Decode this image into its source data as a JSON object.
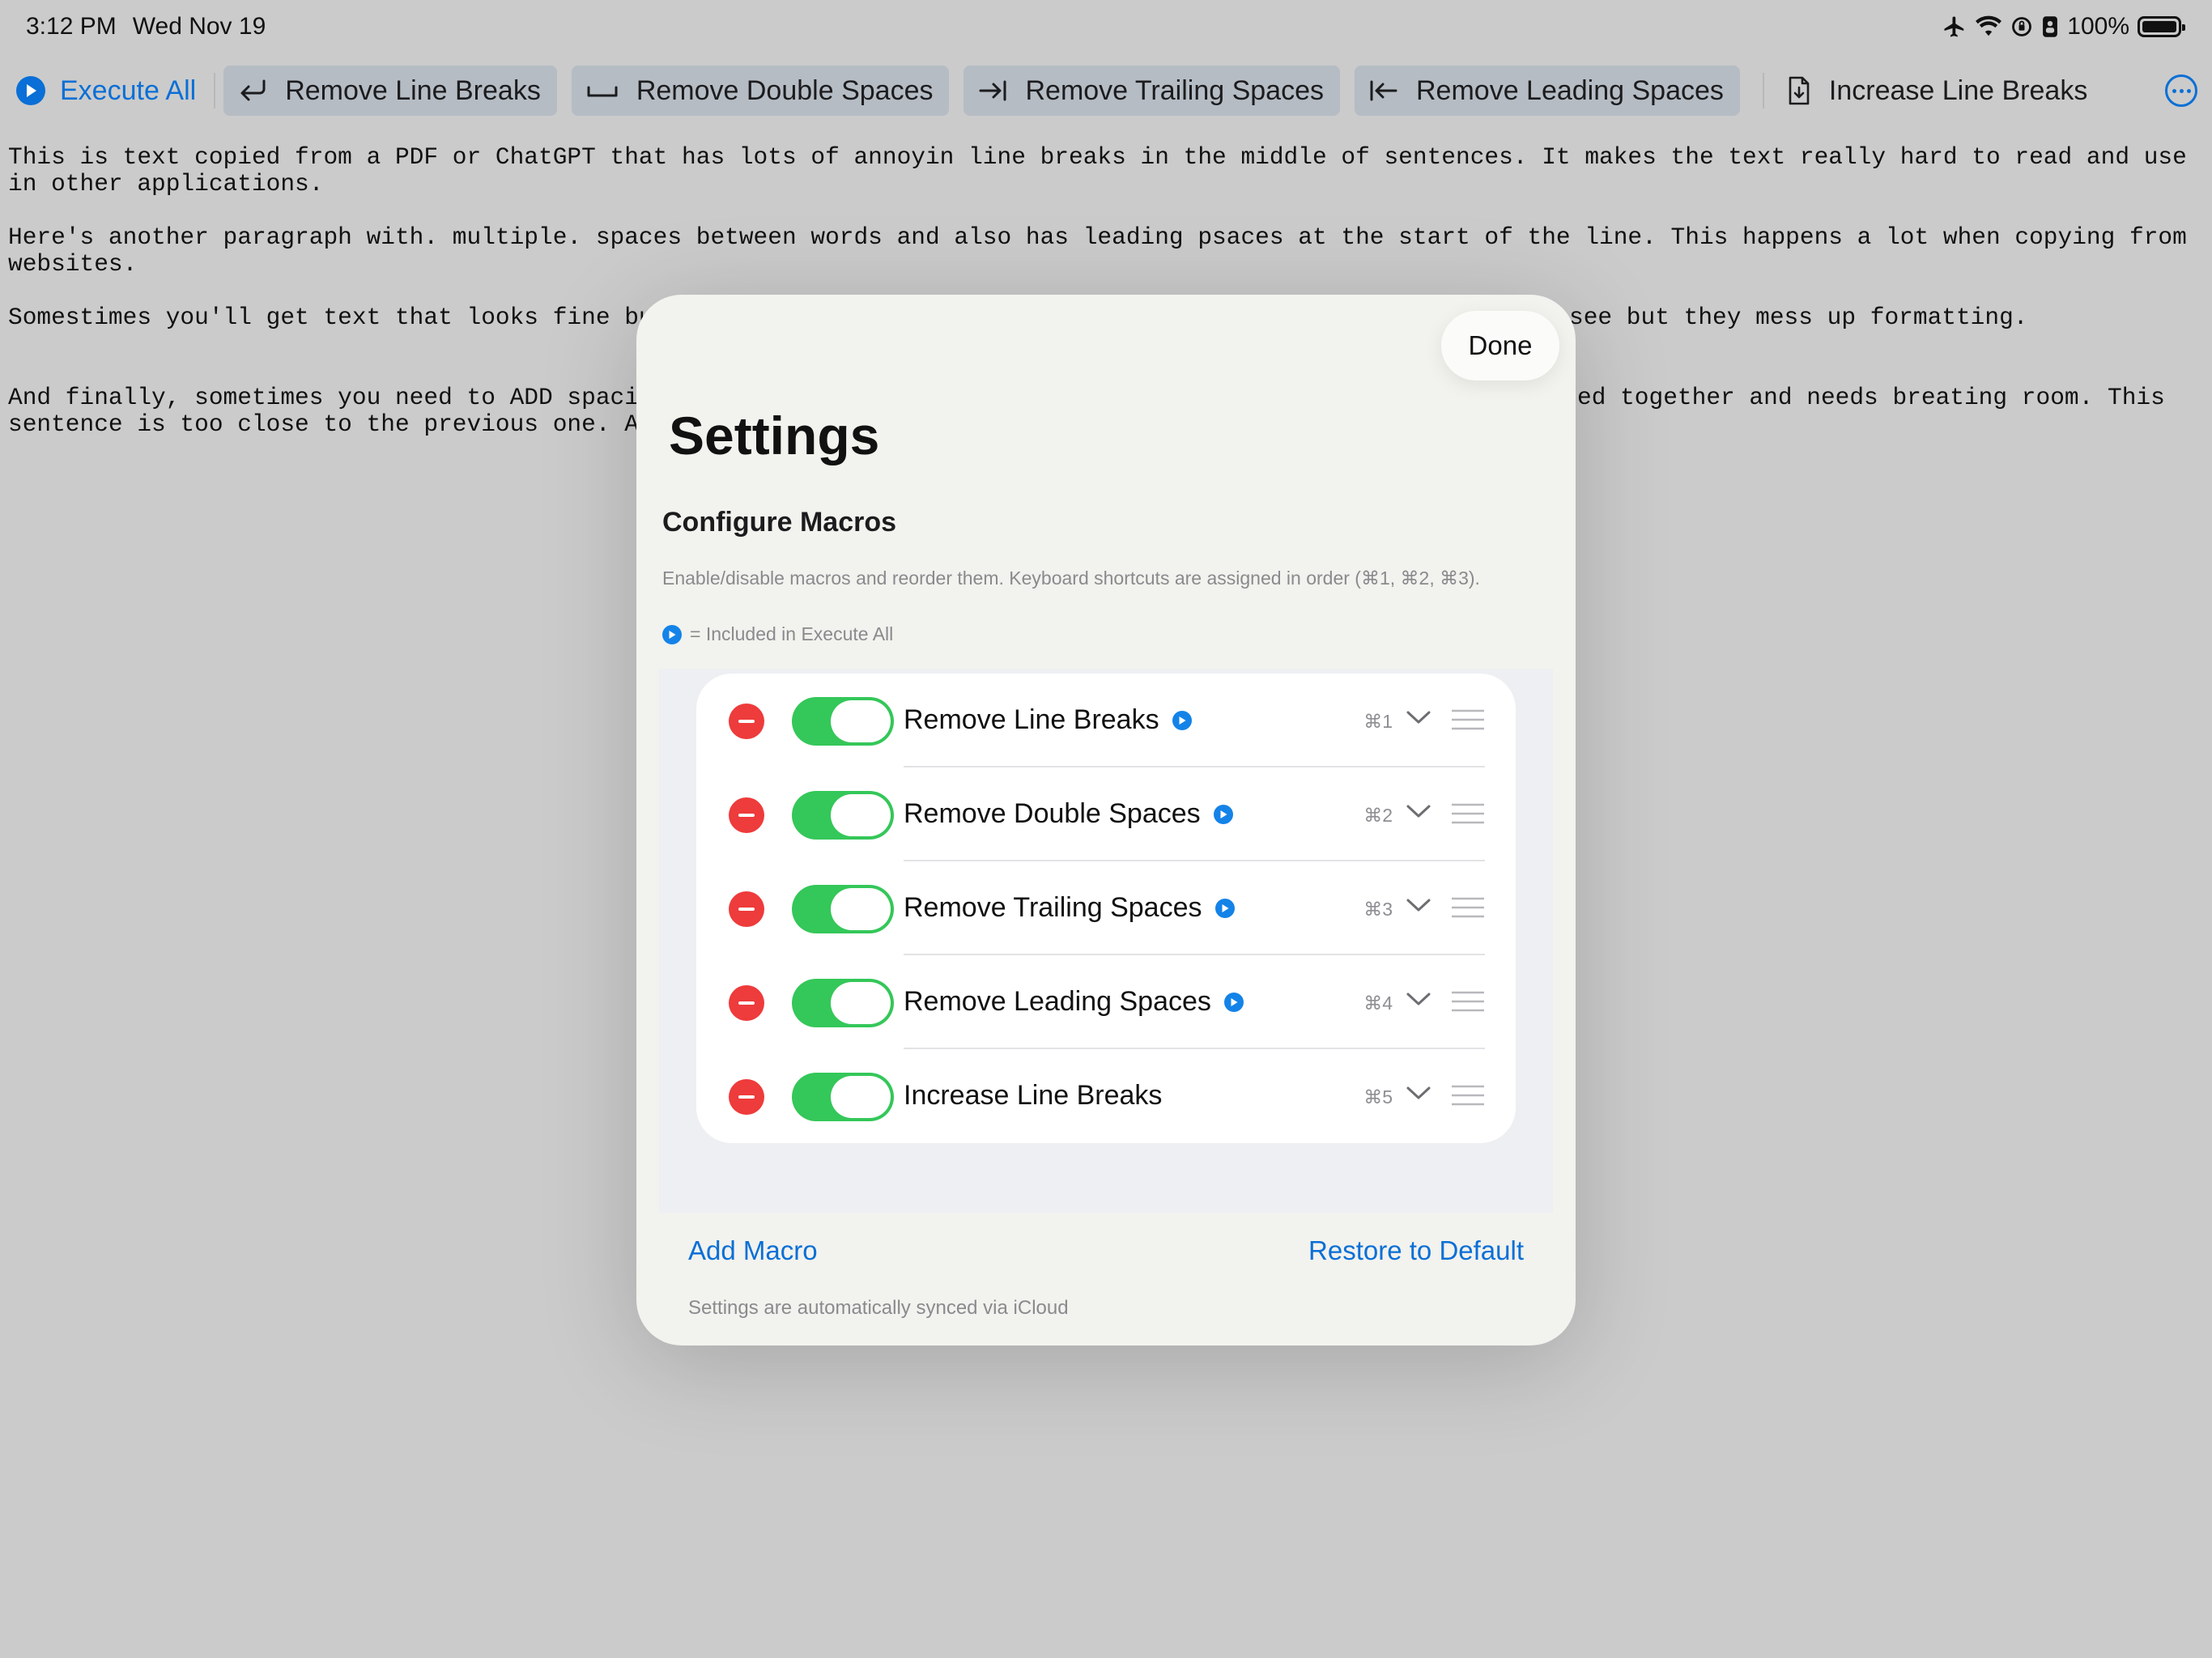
{
  "status_bar": {
    "time": "3:12 PM",
    "date": "Wed Nov 19",
    "battery": "100%"
  },
  "toolbar": {
    "execute_all": "Execute All",
    "buttons": [
      {
        "label": "Remove Line Breaks",
        "icon": "return-arrow-icon"
      },
      {
        "label": "Remove Double Spaces",
        "icon": "space-bar-icon"
      },
      {
        "label": "Remove Trailing Spaces",
        "icon": "arrow-right-to-line-icon"
      },
      {
        "label": "Remove Leading Spaces",
        "icon": "arrow-left-to-line-icon"
      },
      {
        "label": "Increase Line Breaks",
        "icon": "document-arrow-down-icon"
      }
    ],
    "accent": "#0a6fd6"
  },
  "editor": {
    "paragraphs": [
      "This is text copied from a PDF or ChatGPT that has lots of annoyin line breaks in the middle of sentences. It makes the text really hard to read and use in other applications.",
      "Here's another paragraph with. multiple. spaces between words and also has leading psaces at the start of the line. This happens a lot when copying from websites.",
      "Somestimes you'll get text that looks fine but",
      "see but they mess up formatting.",
      "And finally, sometimes you need to ADD spacin",
      "ed together and needs breating room. This",
      "sentence is too close to the previous one. An"
    ]
  },
  "settings": {
    "done": "Done",
    "title": "Settings",
    "section_title": "Configure Macros",
    "description": "Enable/disable macros and reorder them. Keyboard shortcuts are assigned in order (⌘1, ⌘2, ⌘3).",
    "legend": "= Included in Execute All",
    "macros": [
      {
        "name": "Remove Line Breaks",
        "shortcut": "⌘1",
        "enabled": true,
        "in_execute_all": true
      },
      {
        "name": "Remove Double Spaces",
        "shortcut": "⌘2",
        "enabled": true,
        "in_execute_all": true
      },
      {
        "name": "Remove Trailing Spaces",
        "shortcut": "⌘3",
        "enabled": true,
        "in_execute_all": true
      },
      {
        "name": "Remove Leading Spaces",
        "shortcut": "⌘4",
        "enabled": true,
        "in_execute_all": true
      },
      {
        "name": "Increase Line Breaks",
        "shortcut": "⌘5",
        "enabled": true,
        "in_execute_all": false
      }
    ],
    "add_macro": "Add Macro",
    "restore_default": "Restore to Default",
    "sync_note": "Settings are automatically synced via iCloud",
    "colors": {
      "toggle_on": "#34c759",
      "delete": "#ee3b3b",
      "link": "#0a6fd6"
    }
  }
}
